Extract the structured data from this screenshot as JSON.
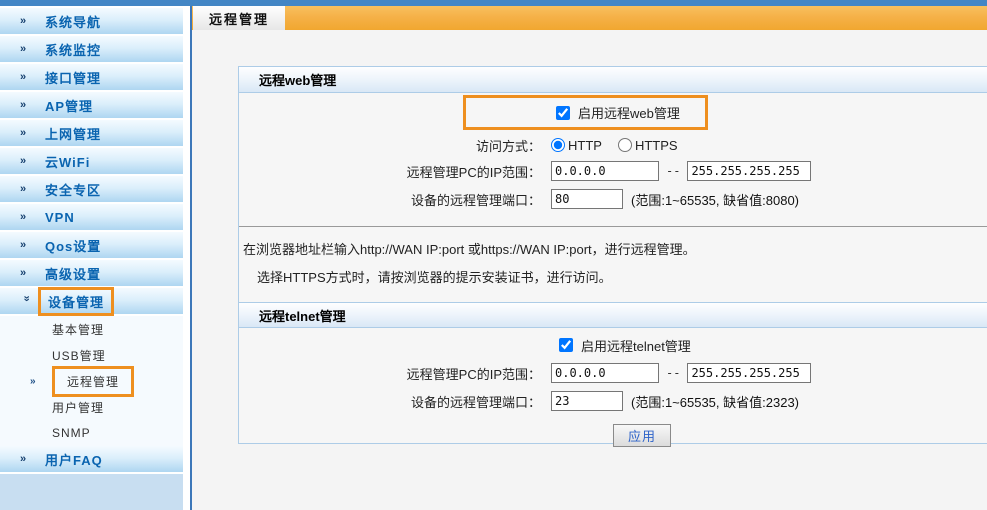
{
  "colors": {
    "top_bar": "#4386C5",
    "tab_strip_orange": "#F2A93B",
    "sidebar_item_blue": "#AED6F1",
    "sidebar_text": "#0A64B0",
    "highlight_orange": "#EE8F1F",
    "panel_border": "#ADCCE7",
    "button_text": "#2C62C9"
  },
  "tab": {
    "label": "远程管理"
  },
  "sidebar": {
    "items": [
      {
        "label": "系统导航"
      },
      {
        "label": "系统监控"
      },
      {
        "label": "接口管理"
      },
      {
        "label": "AP管理"
      },
      {
        "label": "上网管理"
      },
      {
        "label": "云WiFi"
      },
      {
        "label": "安全专区"
      },
      {
        "label": "VPN"
      },
      {
        "label": "Qos设置"
      },
      {
        "label": "高级设置"
      },
      {
        "label": "设备管理"
      }
    ],
    "sub_items": [
      "基本管理",
      "USB管理",
      "远程管理",
      "用户管理",
      "SNMP"
    ],
    "faq_label": "用户FAQ"
  },
  "web": {
    "title": "远程web管理",
    "enabled": true,
    "enable_label": "启用远程web管理",
    "access_label": "访问方式：",
    "http_label": "HTTP",
    "http_selected": true,
    "https_label": "HTTPS",
    "https_selected": false,
    "ip_label": "远程管理PC的IP范围：",
    "ip_start": "0.0.0.0",
    "ip_sep": "--",
    "ip_end": "255.255.255.255",
    "port_label": "设备的远程管理端口：",
    "port_value": "80",
    "port_hint": "(范围:1~65535, 缺省值:8080)",
    "note1": "在浏览器地址栏输入http://WAN IP:port 或https://WAN IP:port，进行远程管理。",
    "note2": "选择HTTPS方式时，请按浏览器的提示安装证书，进行访问。"
  },
  "telnet": {
    "title": "远程telnet管理",
    "enabled": true,
    "enable_label": "启用远程telnet管理",
    "ip_label": "远程管理PC的IP范围：",
    "ip_start": "0.0.0.0",
    "ip_sep": "--",
    "ip_end": "255.255.255.255",
    "port_label": "设备的远程管理端口：",
    "port_value": "23",
    "port_hint": "(范围:1~65535, 缺省值:2323)"
  },
  "apply_label": "应用"
}
